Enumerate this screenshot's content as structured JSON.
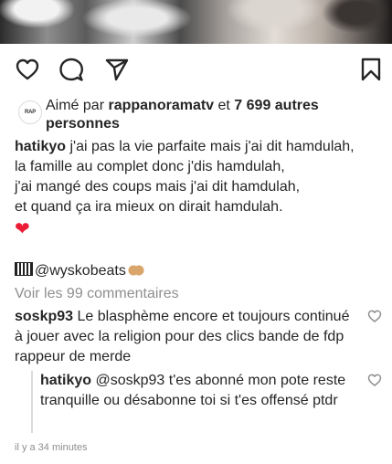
{
  "post": {
    "icons": {
      "like": "heart-outline-icon",
      "comment": "comment-bubble-icon",
      "share": "paper-plane-icon",
      "save": "bookmark-icon"
    }
  },
  "likes": {
    "logo_text": "RAP",
    "prefix": "Aimé par ",
    "user": "rappanoramatv",
    "middle": " et ",
    "count": "7 699 autres personnes"
  },
  "caption": {
    "user": "hatikyo",
    "lines": [
      "j'ai pas la vie parfaite mais j'ai dit hamdulah,",
      "la famille au complet donc j'dis hamdulah,",
      "j'ai mangé des coups mais j'ai dit hamdulah,",
      "et quand ça ira mieux on dirait hamdulah."
    ],
    "emoji": "❤"
  },
  "credit": {
    "mention": "@wyskobeats"
  },
  "view_comments": "Voir les 99 commentaires",
  "comments": [
    {
      "user": "soskp93",
      "text": "Le blasphème encore et toujours continué à jouer avec la religion pour des clics bande de fdp rappeur de merde"
    },
    {
      "user": "hatikyo",
      "text": "@soskp93 t'es abonné mon pote reste tranquille ou désabonne toi si t'es offensé ptdr"
    }
  ],
  "timestamp": "il y a 34 minutes",
  "colors": {
    "text": "#262626",
    "muted": "#8e8e8e",
    "heart": "#ed1c36"
  }
}
